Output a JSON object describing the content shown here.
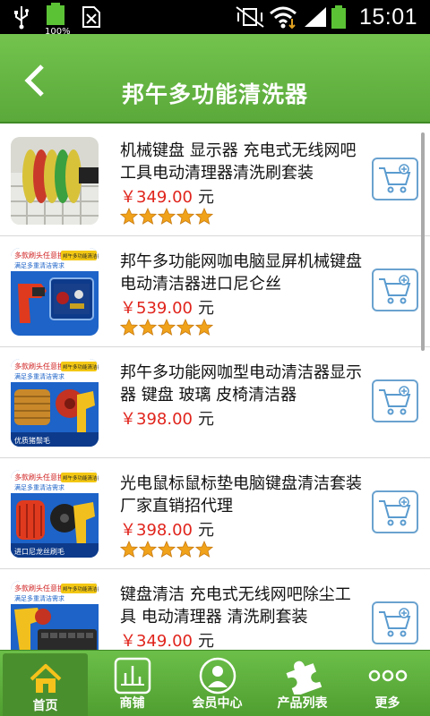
{
  "status_bar": {
    "time": "15:01",
    "battery_text": "100%"
  },
  "header": {
    "title": "邦午多功能清洗器"
  },
  "products": [
    {
      "name": "机械键盘 显示器 充电式无线网吧工具电动清理器清洗刷套装",
      "price": "￥349.00",
      "unit": "元",
      "rating": 5,
      "has_rating": true,
      "thumb": "keyboard-brush-photo"
    },
    {
      "name": "邦午多功能网咖电脑显屏机械键盘电动清洁器进口尼仑丝",
      "price": "￥539.00",
      "unit": "元",
      "rating": 5,
      "has_rating": true,
      "thumb": "drill-kit-photo"
    },
    {
      "name": "邦午多功能网咖型电动清洁器显示器 键盘 玻璃 皮椅清洁器",
      "price": "￥398.00",
      "unit": "元",
      "rating": 0,
      "has_rating": false,
      "thumb": "drill-brush-photo"
    },
    {
      "name": "光电鼠标鼠标垫电脑键盘清洁套装厂家直销招代理",
      "price": "￥398.00",
      "unit": "元",
      "rating": 5,
      "has_rating": true,
      "thumb": "drill-brush-photo-2"
    },
    {
      "name": "键盘清洁 充电式无线网吧除尘工具 电动清理器 清洗刷套装",
      "price": "￥349.00",
      "unit": "元",
      "rating": 0,
      "has_rating": false,
      "thumb": "drill-keyboard-photo"
    }
  ],
  "thumb_banners": {
    "b1_top": "多款刷头任意换",
    "b1_tag": "邦午多功能清洁器",
    "b1_sub": "满足多重清洁需求",
    "b3_bottom": "优质猪鬃毛",
    "b4_bottom": "进口尼龙丝刷毛"
  },
  "bottom_nav": [
    {
      "label": "首页",
      "icon": "home-icon"
    },
    {
      "label": "商铺",
      "icon": "bar-chart-icon"
    },
    {
      "label": "会员中心",
      "icon": "member-icon"
    },
    {
      "label": "产品列表",
      "icon": "puzzle-icon"
    },
    {
      "label": "更多",
      "icon": "more-icon"
    }
  ],
  "colors": {
    "header": "#5fae3c",
    "price": "#e0241c",
    "cart_border": "#6aa2cf",
    "star": "#f0a21a"
  }
}
